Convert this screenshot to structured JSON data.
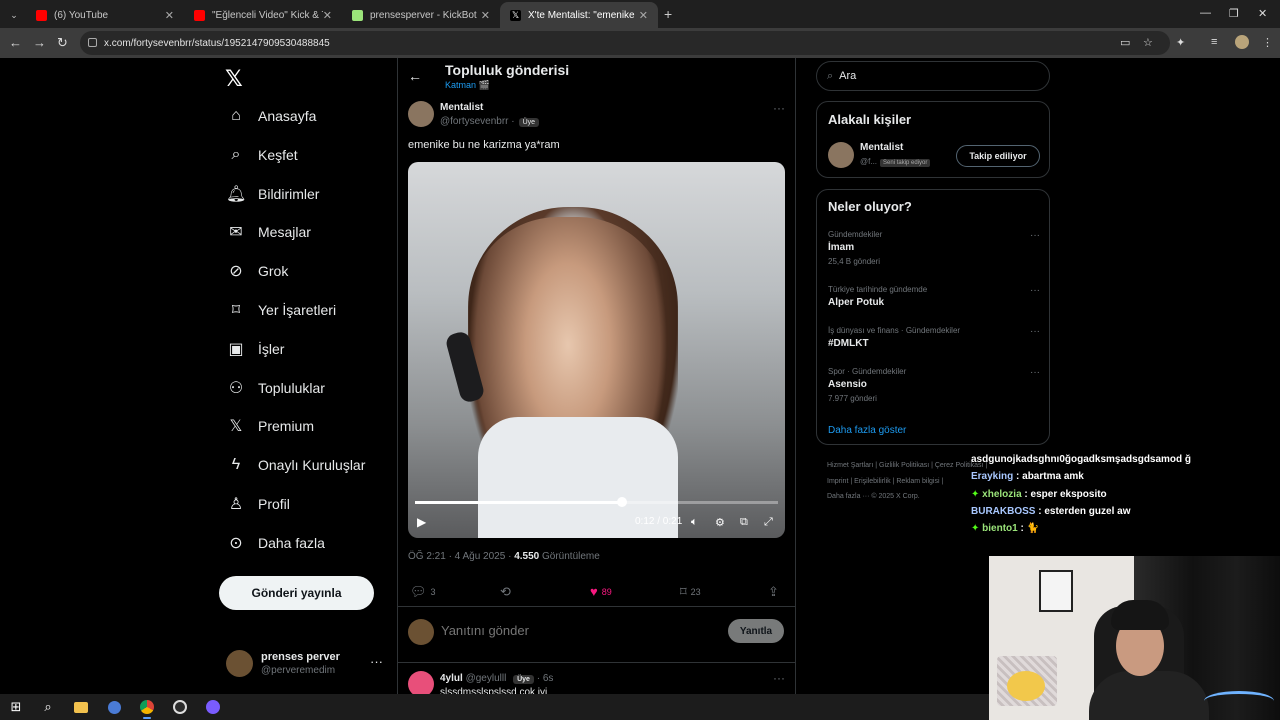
{
  "browser": {
    "tabs": [
      {
        "label": "(6) YouTube",
        "color": "#ff0000"
      },
      {
        "label": "\"Eğlenceli Video\" Kick & Twitch",
        "color": "#ff0000"
      },
      {
        "label": "prensesperver - KickBot",
        "color": "#53fc18"
      },
      {
        "label": "X'te Mentalist: \"emenike bu ne",
        "color": "#ffffff"
      }
    ],
    "url": "x.com/fortysevenbrr/status/1952147909530488845"
  },
  "nav": {
    "items": [
      {
        "label": "Anasayfa",
        "icon": "home-icon"
      },
      {
        "label": "Keşfet",
        "icon": "search-icon"
      },
      {
        "label": "Bildirimler",
        "icon": "bell-icon"
      },
      {
        "label": "Mesajlar",
        "icon": "mail-icon"
      },
      {
        "label": "Grok",
        "icon": "grok-icon"
      },
      {
        "label": "Yer İşaretleri",
        "icon": "bookmark-icon"
      },
      {
        "label": "İşler",
        "icon": "briefcase-icon"
      },
      {
        "label": "Topluluklar",
        "icon": "people-icon"
      },
      {
        "label": "Premium",
        "icon": "x-icon"
      },
      {
        "label": "Onaylı Kuruluşlar",
        "icon": "bolt-icon"
      },
      {
        "label": "Profil",
        "icon": "person-icon"
      },
      {
        "label": "Daha fazla",
        "icon": "more-circle-icon"
      }
    ],
    "post_button": "Gönderi yayınla",
    "account": {
      "name": "prenses perver",
      "handle": "@perveremedim"
    }
  },
  "post": {
    "header_title": "Topluluk gönderisi",
    "header_sub": "Katman 🎬",
    "author_name": "Mentalist",
    "author_handle": "@fortysevenbrr",
    "badge": "Üye",
    "text": "emenike bu ne karizma ya*ram",
    "video": {
      "time": "0:12 / 0:21",
      "progress": 0.57
    },
    "meta_time": "ÖĞ 2:21 · 4 Ağu 2025 · ",
    "views": "4.550",
    "views_label": " Görüntüleme",
    "actions": {
      "replies": "3",
      "reposts": "",
      "likes": "89",
      "bookmarks": "23"
    },
    "reply_placeholder": "Yanıtını gönder",
    "reply_button": "Yanıtla"
  },
  "comment": {
    "name": "4ylul",
    "handle": "@geylulll",
    "badge": "Üye",
    "time": "· 6s",
    "text": "slssdmsslspslssd çok iyi"
  },
  "right": {
    "search_placeholder": "Ara",
    "relevant_title": "Alakalı kişiler",
    "relevant_person": {
      "name": "Mentalist",
      "handle": "@f...",
      "badge": "Seni takip ediyor",
      "button": "Takip ediliyor"
    },
    "trends_title": "Neler oluyor?",
    "trends": [
      {
        "category": "Gündemdekiler",
        "name": "İmam",
        "count": "25,4 B gönderi"
      },
      {
        "category": "Türkiye tarihinde gündemde",
        "name": "Alper Potuk",
        "count": ""
      },
      {
        "category": "İş dünyası ve finans · Gündemdekiler",
        "name": "#DMLKT",
        "count": ""
      },
      {
        "category": "Spor · Gündemdekiler",
        "name": "Asensio",
        "count": "7.977 gönderi"
      }
    ],
    "show_more": "Daha fazla göster",
    "footer_line1": "Hizmet Şartları  |  Gizlilik Politikası  |  Çerez Politikası  |",
    "footer_line2": "Imprint  |  Erişilebilirlik  |  Reklam bilgisi  |",
    "footer_line3": "Daha fazla ···   © 2025 X Corp."
  },
  "chat": [
    {
      "user": "",
      "text": "asdgunojkadsghnı0ğogadksmşadsgdsamod ğ"
    },
    {
      "user": "Erayking",
      "text": " : abartma amk"
    },
    {
      "user": "xhelozia",
      "text": " : esper eksposito"
    },
    {
      "user": "BURAKBOSS",
      "text": " : esterden guzel aw"
    },
    {
      "user": "biento1",
      "text": " : 🐈"
    }
  ]
}
